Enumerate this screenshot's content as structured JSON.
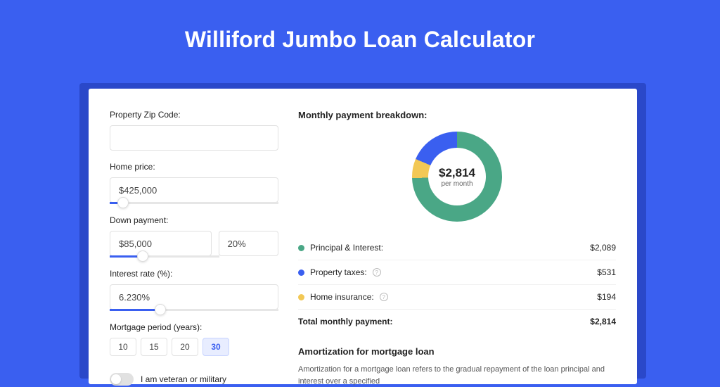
{
  "page": {
    "title": "Williford Jumbo Loan Calculator"
  },
  "form": {
    "zip": {
      "label": "Property Zip Code:",
      "value": ""
    },
    "home_price": {
      "label": "Home price:",
      "value": "$425,000",
      "slider_pct": 8
    },
    "down_payment": {
      "label": "Down payment:",
      "value": "$85,000",
      "pct_value": "20%",
      "slider_pct": 20
    },
    "interest": {
      "label": "Interest rate (%):",
      "value": "6.230%",
      "slider_pct": 30
    },
    "period": {
      "label": "Mortgage period (years):",
      "options": [
        "10",
        "15",
        "20",
        "30"
      ],
      "selected": "30"
    },
    "veteran": {
      "label": "I am veteran or military",
      "value": false
    }
  },
  "breakdown": {
    "title": "Monthly payment breakdown:",
    "center_amount": "$2,814",
    "center_sub": "per month",
    "rows": [
      {
        "dot": "green",
        "label": "Principal & Interest:",
        "info": false,
        "value": "$2,089"
      },
      {
        "dot": "blue",
        "label": "Property taxes:",
        "info": true,
        "value": "$531"
      },
      {
        "dot": "yellow",
        "label": "Home insurance:",
        "info": true,
        "value": "$194"
      }
    ],
    "total": {
      "label": "Total monthly payment:",
      "value": "$2,814"
    }
  },
  "amortization": {
    "title": "Amortization for mortgage loan",
    "text": "Amortization for a mortgage loan refers to the gradual repayment of the loan principal and interest over a specified"
  },
  "chart_data": {
    "type": "pie",
    "title": "Monthly payment breakdown",
    "series": [
      {
        "name": "Principal & Interest",
        "value": 2089,
        "color": "#4aa786"
      },
      {
        "name": "Property taxes",
        "value": 531,
        "color": "#3a5ff0"
      },
      {
        "name": "Home insurance",
        "value": 194,
        "color": "#f2c855"
      }
    ],
    "total": 2814
  }
}
